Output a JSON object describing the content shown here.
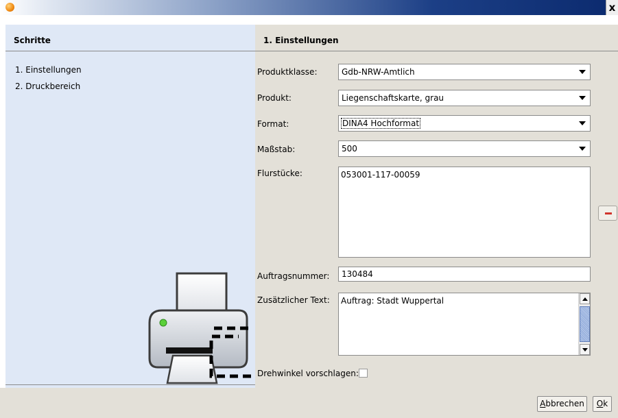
{
  "window": {
    "close_label": "x",
    "app_icon": "orange-app-icon"
  },
  "left": {
    "title": "Schritte",
    "steps": [
      {
        "label": "1. Einstellungen"
      },
      {
        "label": "2. Druckbereich"
      }
    ],
    "illustration": "printer-illustration"
  },
  "right": {
    "title": "1. Einstellungen",
    "fields": {
      "produktklasse": {
        "label": "Produktklasse:",
        "value": "Gdb-NRW-Amtlich"
      },
      "produkt": {
        "label": "Produkt:",
        "value": "Liegenschaftskarte, grau"
      },
      "format": {
        "label": "Format:",
        "value": "DINA4 Hochformat"
      },
      "massstab": {
        "label": "Maßstab:",
        "value": "500"
      },
      "flurstuecke": {
        "label": "Flurstücke:",
        "value": "053001-117-00059"
      },
      "auftragsnummer": {
        "label": "Auftragsnummer:",
        "value": "130484"
      },
      "zusatztext": {
        "label": "Zusätzlicher Text:",
        "value": "Auftrag: Stadt Wuppertal"
      },
      "drehwinkel": {
        "label": "Drehwinkel vorschlagen:",
        "checked": false
      }
    }
  },
  "footer": {
    "cancel": {
      "mnemonic": "A",
      "rest": "bbrechen"
    },
    "ok": {
      "mnemonic": "O",
      "rest": "k"
    }
  },
  "colors": {
    "left_panel": "#dfe8f6",
    "right_panel": "#e3e0d8",
    "remove_accent": "#d0342c"
  }
}
